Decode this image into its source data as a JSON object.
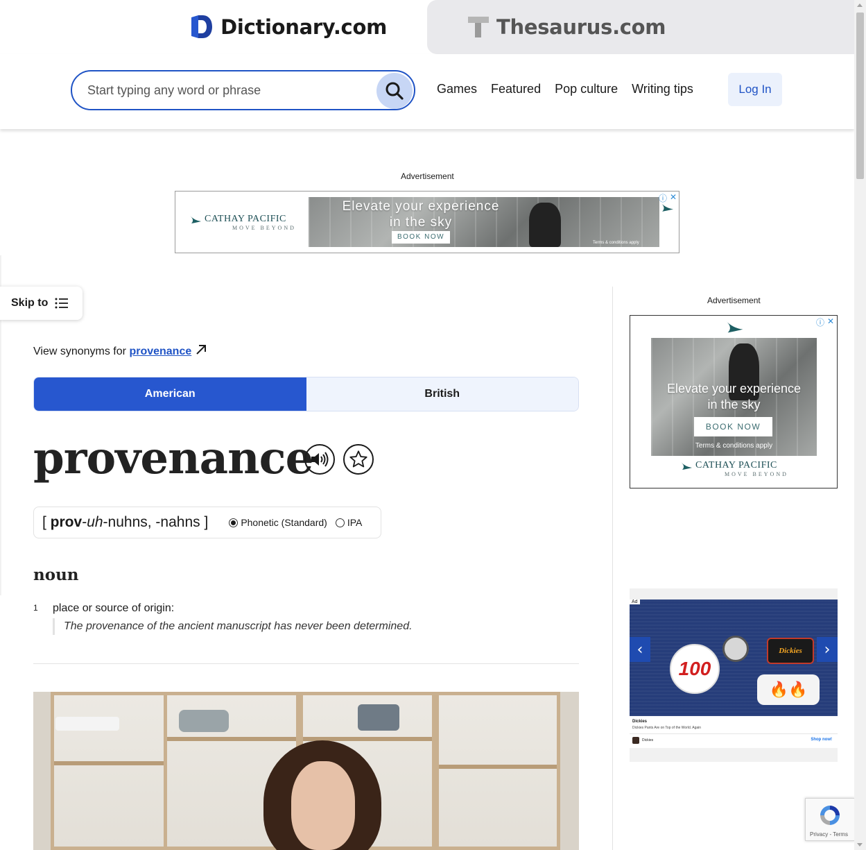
{
  "brands": {
    "dictionary": "Dictionary.com",
    "thesaurus": "Thesaurus.com"
  },
  "search": {
    "placeholder": "Start typing any word or phrase"
  },
  "nav": {
    "items": [
      "Games",
      "Featured",
      "Pop culture",
      "Writing tips"
    ],
    "login": "Log In"
  },
  "ads": {
    "label": "Advertisement",
    "top_banner": {
      "brand": "CATHAY PACIFIC",
      "tagline": "MOVE BEYOND",
      "headline_1": "Elevate your experience",
      "headline_2": "in the sky",
      "cta": "BOOK NOW",
      "terms": "Terms & conditions apply"
    },
    "side_banner": {
      "brand": "CATHAY PACIFIC",
      "tagline": "MOVE BEYOND",
      "headline_1": "Elevate your experience",
      "headline_2": "in the sky",
      "cta": "BOOK NOW",
      "terms": "Terms & conditions apply"
    },
    "dickies": {
      "badge": "Ad",
      "patch_100": "100",
      "patch_brand": "Dickies",
      "title": "Dickies",
      "subtitle": "Dickies Pants Are on Top of the World. Again",
      "advertiser": "Dickies",
      "cta": "Shop now!"
    }
  },
  "skip": {
    "label": "Skip to"
  },
  "entry": {
    "view_synonyms_prefix": "View synonyms for",
    "synonym_link": "provenance",
    "tabs": [
      "American",
      "British"
    ],
    "active_tab": "American",
    "headword": "provenance",
    "pronunciation": {
      "open": "[ ",
      "bold": "prov",
      "sep1": "-",
      "italic": "uh",
      "rest": "-nuhns, -nahns",
      "close": " ]"
    },
    "pron_options": [
      {
        "label": "Phonetic (Standard)",
        "selected": true
      },
      {
        "label": "IPA",
        "selected": false
      }
    ],
    "part_of_speech": "noun",
    "definitions": [
      {
        "number": "1",
        "text": "place or source of origin:",
        "example": "The provenance of the ancient manuscript has never been determined."
      }
    ]
  },
  "recaptcha": {
    "text": "Privacy - Terms"
  },
  "colors": {
    "primary_blue": "#2757cf",
    "link_blue": "#1f53c5",
    "tab_inactive": "#eff4fd"
  }
}
